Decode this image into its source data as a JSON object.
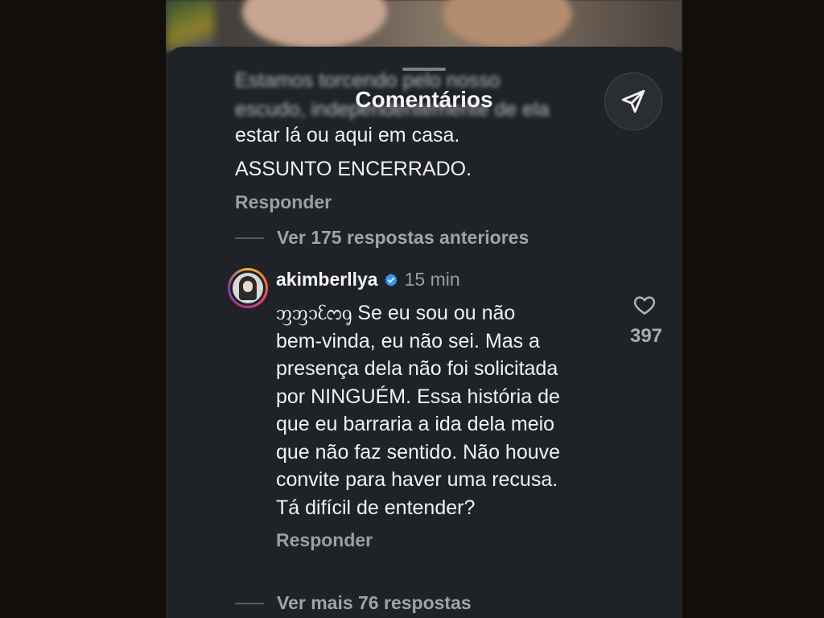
{
  "sheet": {
    "title": "Comentários"
  },
  "blurred_lines": [
    "Estamos torcendo pelo nosso",
    "escudo, independentemente de ela"
  ],
  "previous_comment": {
    "lines": [
      "estar lá ou aqui em casa.",
      "ASSUNTO ENCERRADO."
    ],
    "reply_label": "Responder"
  },
  "replies_before": {
    "label": "Ver 175 respostas anteriores"
  },
  "comment": {
    "username": "akimberllya",
    "verified": true,
    "time": "15 min",
    "lines": [
      "ᦀᦀᦱᦷᦂᧁ Se eu sou ou não",
      "bem-vinda, eu não sei. Mas a",
      "presença dela não foi solicitada",
      "por NINGUÉM. Essa história de",
      "que eu barraria a ida dela meio",
      "que não faz sentido. Não houve",
      "convite para haver uma recusa.",
      "Tá difícil de entender?"
    ],
    "likes": "397",
    "reply_label": "Responder"
  },
  "more_replies": {
    "label": "Ver mais 76 respostas"
  },
  "icons": {
    "send": "send-icon",
    "like": "heart-icon",
    "verified": "verified-badge-icon",
    "avatar": "avatar"
  },
  "colors": {
    "verified": "#3897f0",
    "sheet": "#1f2226",
    "accent_ring": "#c13584"
  }
}
